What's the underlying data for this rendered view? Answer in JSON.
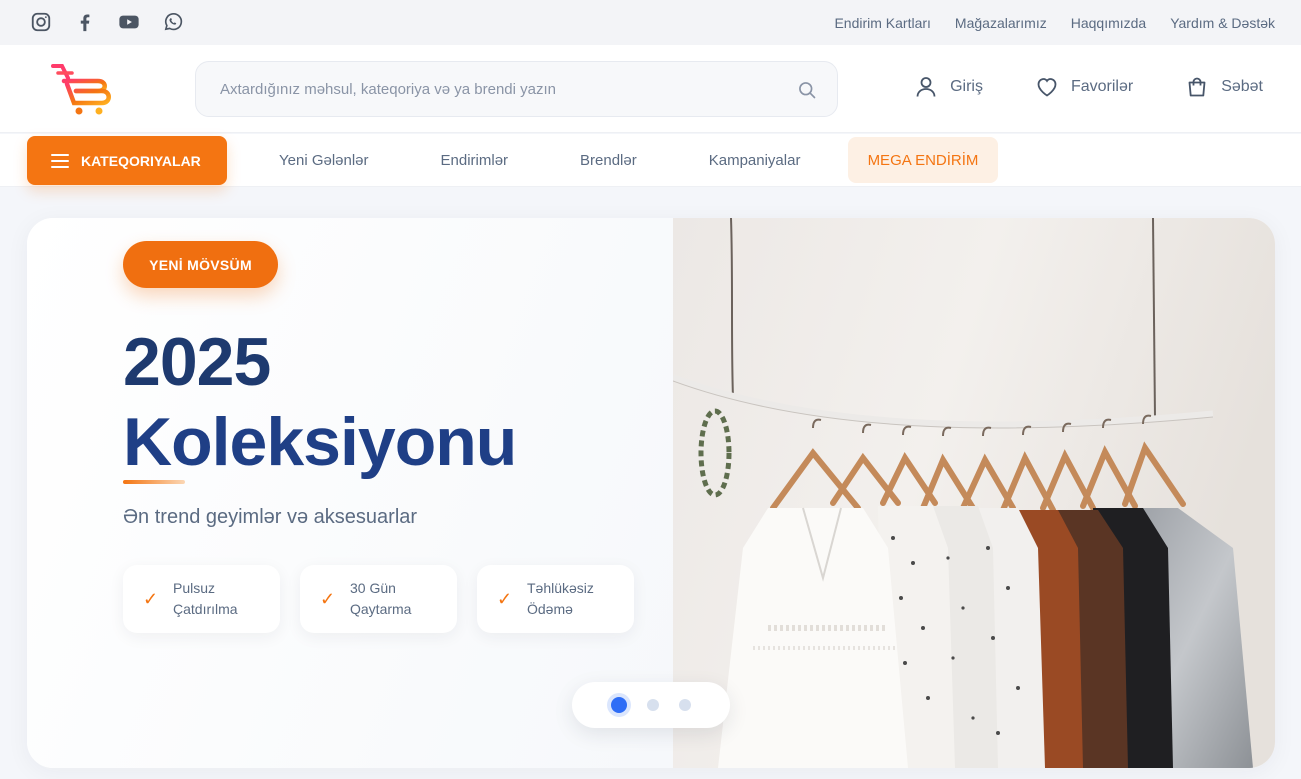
{
  "topbar": {
    "social": [
      "instagram-icon",
      "facebook-icon",
      "youtube-icon",
      "whatsapp-icon"
    ],
    "links": [
      "Endirim Kartları",
      "Mağazalarımız",
      "Haqqımızda",
      "Yardım & Dəstək"
    ]
  },
  "header": {
    "logo_icon": "cart-logo-icon",
    "search": {
      "placeholder": "Axtardığınız məhsul, kateqoriya və ya brendi yazın",
      "value": ""
    },
    "actions": {
      "login": "Giriş",
      "favorites": "Favorilər",
      "cart": "Səbət"
    }
  },
  "nav": {
    "categories_label": "KATEQORIYALAR",
    "links": [
      "Yeni Gələnlər",
      "Endirimlər",
      "Brendlər",
      "Kampaniyalar"
    ],
    "mega": "MEGA ENDİRİM"
  },
  "hero": {
    "badge": "YENİ MÖVSÜM",
    "title_line1": "2025",
    "title_line2": "Koleksiyonu",
    "subtitle": "Ən trend geyimlər və aksesuarlar",
    "features": [
      {
        "icon": "check-icon",
        "text": "Pulsuz Çatdırılma"
      },
      {
        "icon": "check-icon",
        "text": "30 Gün Qaytarma"
      },
      {
        "icon": "check-icon",
        "text": "Təhlükəsiz Ödəmə"
      }
    ],
    "image": "clothes-rack-photo",
    "carousel": {
      "slides": 3,
      "active": 1
    }
  },
  "colors": {
    "accent": "#f47512",
    "title": "#1e3a6f",
    "carousel_active": "#2e6df6",
    "mega_bg": "#fdf0e4"
  }
}
